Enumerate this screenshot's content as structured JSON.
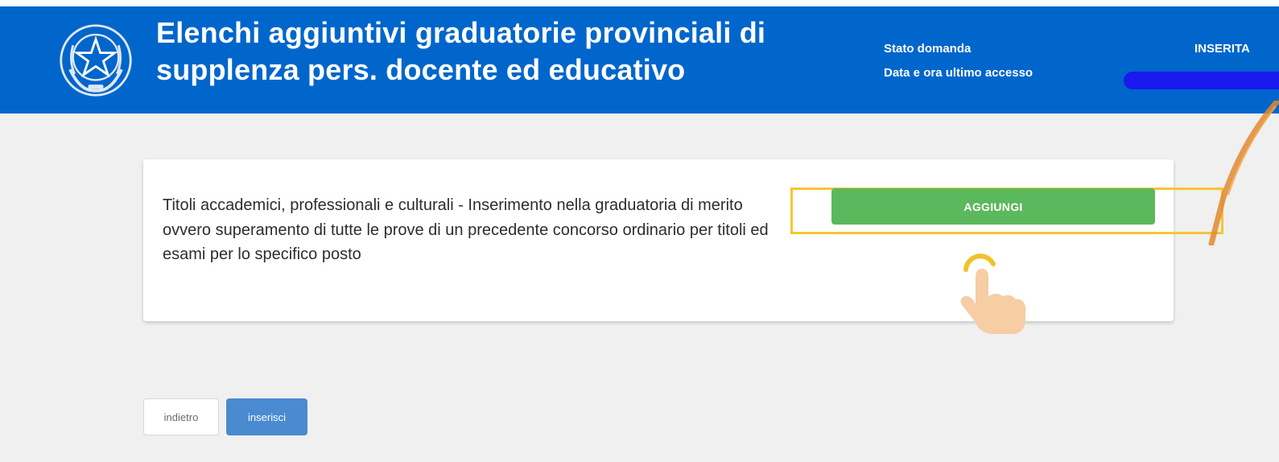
{
  "colors": {
    "header_bg": "#0066cc",
    "content_bg": "#f0f0f0",
    "add_button": "#5cb85c",
    "insert_button": "#4a8ad1",
    "highlight": "#f7c531"
  },
  "header": {
    "logo_icon": "republic-emblem-icon",
    "title": "Elenchi aggiuntivi graduatorie provinciali di supplenza pers. docente ed educativo",
    "status_label": "Stato domanda",
    "status_value": "INSERITA",
    "last_access_label": "Data e ora ultimo accesso"
  },
  "card": {
    "description": "Titoli accademici, professionali e culturali - Inserimento nella graduatoria di merito ovvero superamento di tutte le prove di un precedente concorso ordinario per titoli ed esami per lo specifico posto",
    "add_label": "AGGIUNGI",
    "pointer_icon": "pointing-hand-icon"
  },
  "footer": {
    "back_label": "indietro",
    "insert_label": "inserisci"
  }
}
